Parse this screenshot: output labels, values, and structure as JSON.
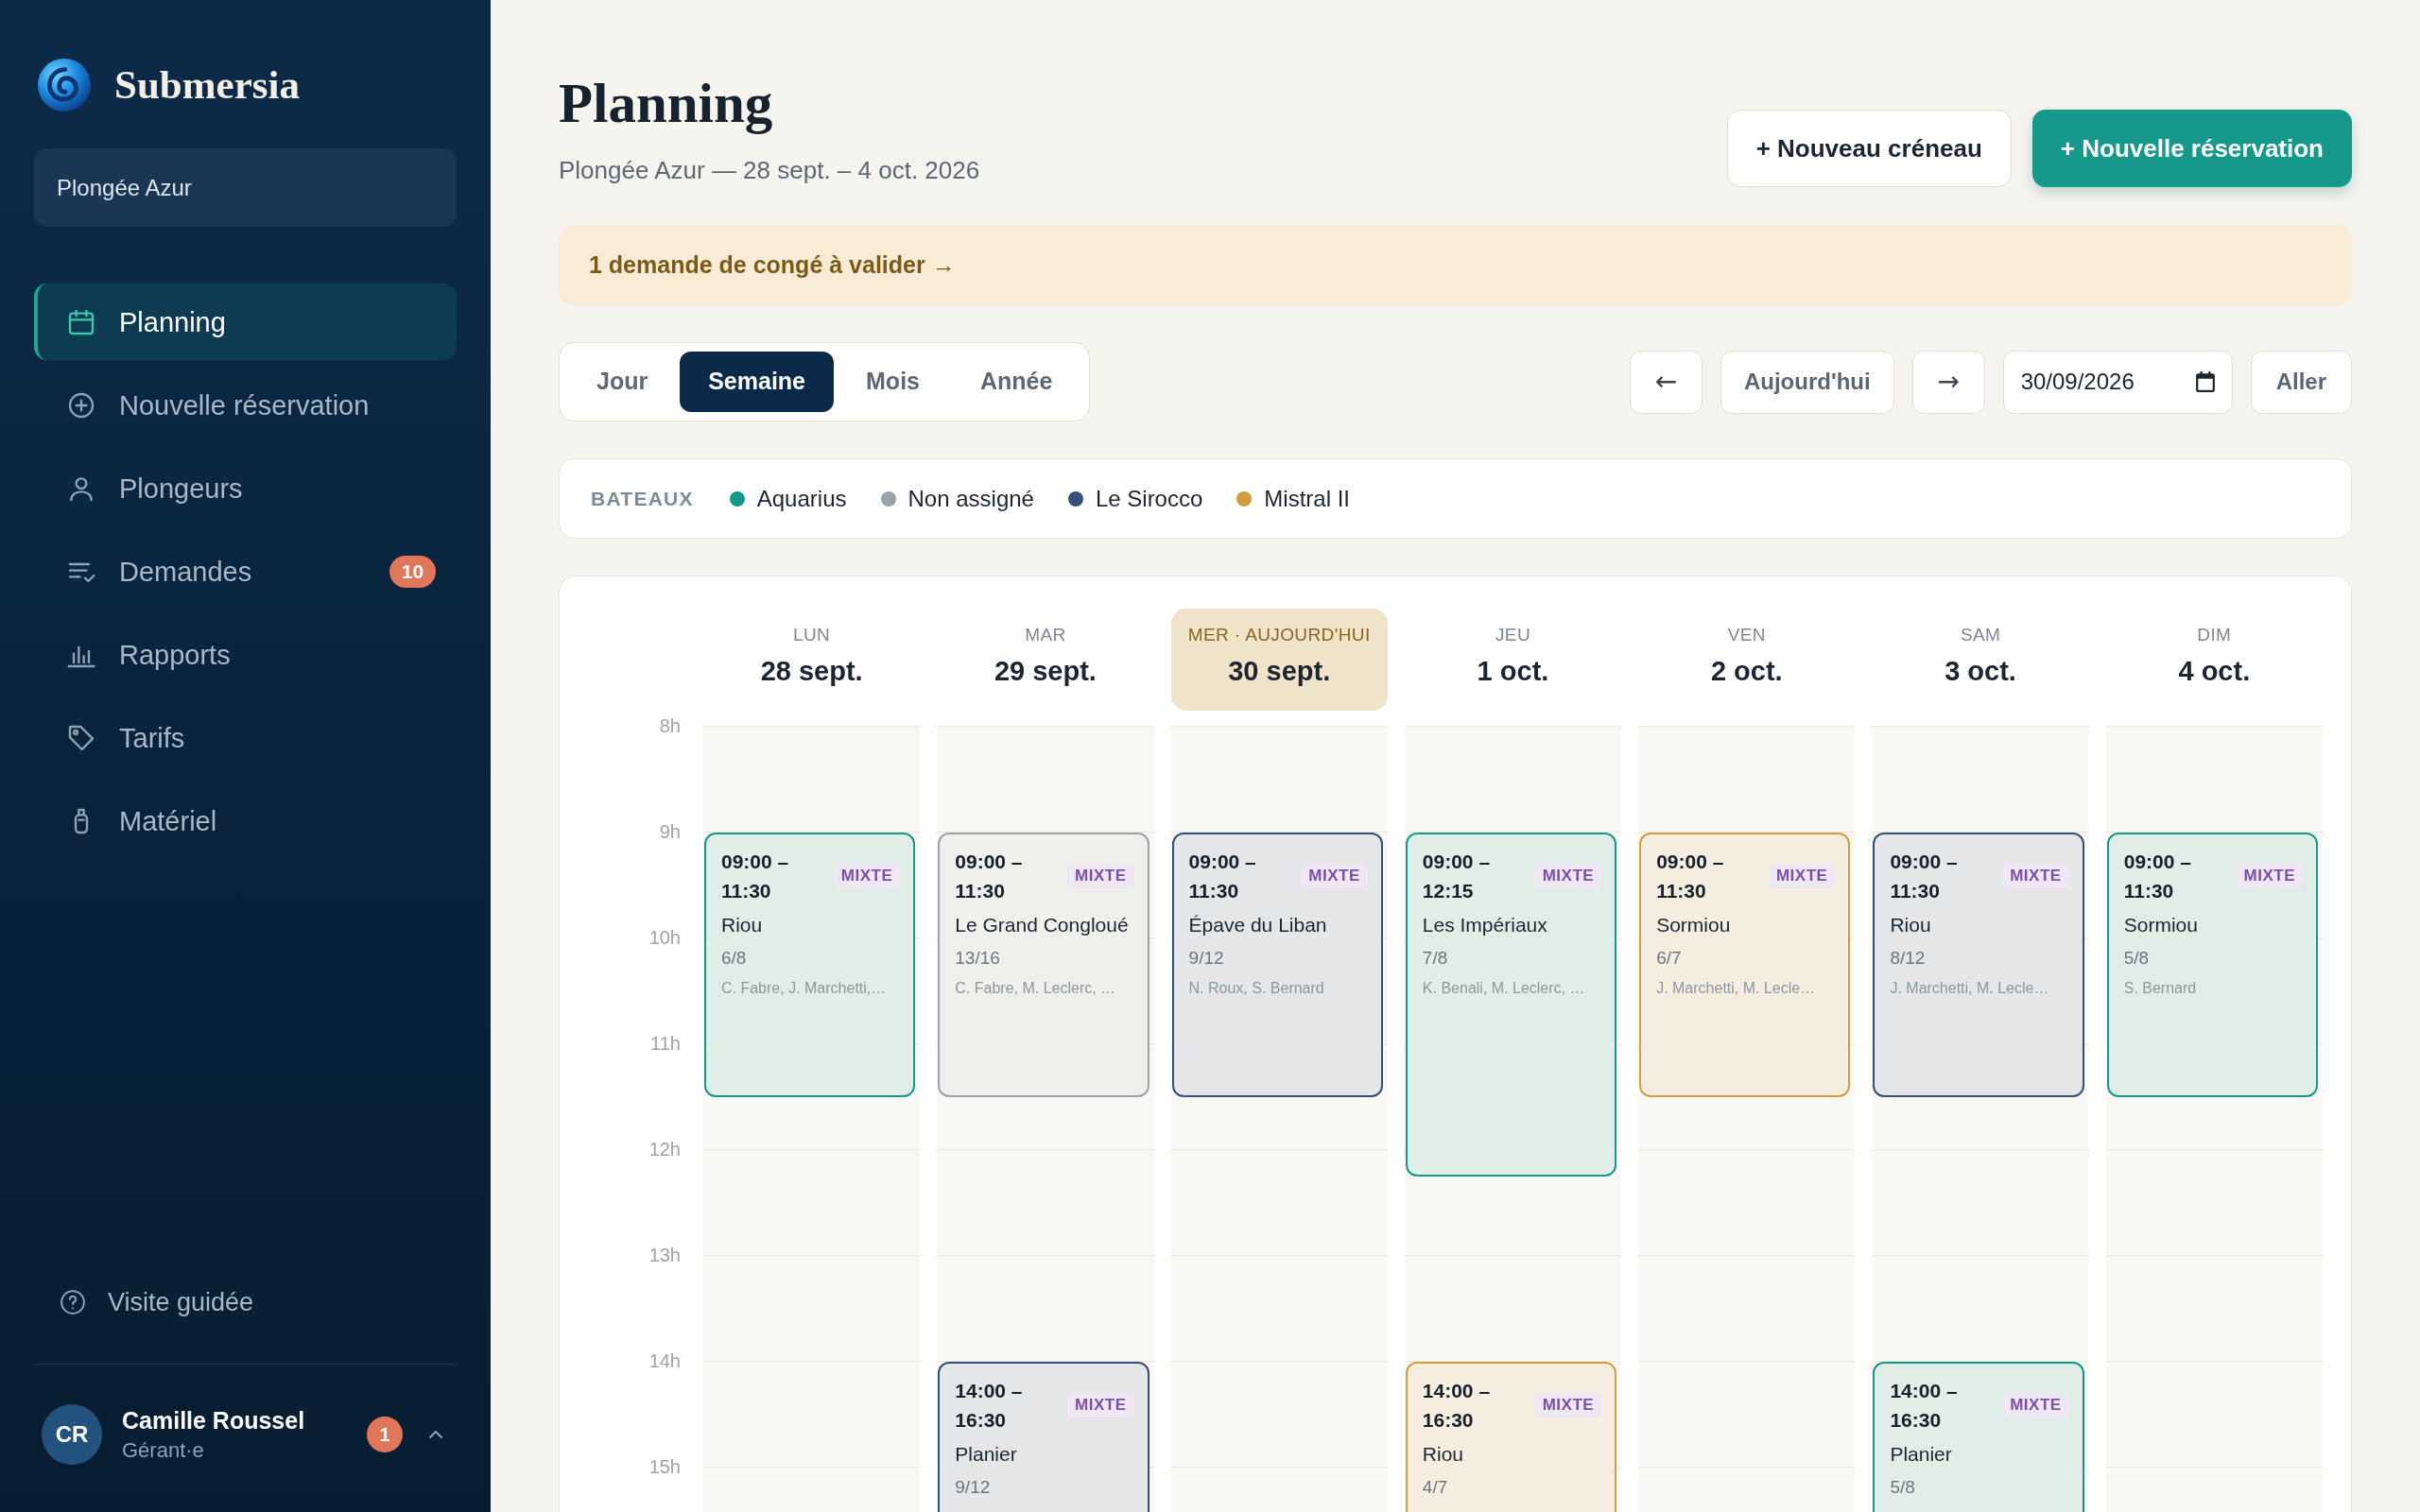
{
  "sidebar": {
    "brand": "Submersia",
    "organization": "Plongée Azur",
    "nav": [
      {
        "label": "Planning",
        "selected": true
      },
      {
        "label": "Nouvelle réservation",
        "selected": false
      },
      {
        "label": "Plongeurs",
        "selected": false
      },
      {
        "label": "Demandes",
        "selected": false,
        "badge": "10"
      },
      {
        "label": "Rapports",
        "selected": false
      },
      {
        "label": "Tarifs",
        "selected": false
      },
      {
        "label": "Matériel",
        "selected": false
      }
    ],
    "help": "Visite guidée",
    "user": {
      "initials": "CR",
      "name": "Camille Roussel",
      "role": "Gérant·e",
      "badge": "1"
    }
  },
  "header": {
    "title": "Planning",
    "subtitle": "Plongée Azur — 28 sept. – 4 oct. 2026",
    "actions": [
      {
        "label": "+ Nouveau créneau",
        "kind": "secondary"
      },
      {
        "label": "+ Nouvelle réservation",
        "kind": "primary"
      }
    ]
  },
  "alert": {
    "text": "1 demande de congé à valider →"
  },
  "views": [
    {
      "label": "Jour",
      "selected": false
    },
    {
      "label": "Semaine",
      "selected": true
    },
    {
      "label": "Mois",
      "selected": false
    },
    {
      "label": "Année",
      "selected": false
    }
  ],
  "navigation": {
    "previous": "←",
    "today": "Aujourd'hui",
    "next": "→",
    "date": "30/09/2026",
    "go": "Aller"
  },
  "legend": {
    "title": "BATEAUX",
    "boats": [
      {
        "name": "Aquarius",
        "color": "#14998a"
      },
      {
        "name": "Non assigné",
        "color": "#9aa2ab"
      },
      {
        "name": "Le Sirocco",
        "color": "#34507a"
      },
      {
        "name": "Mistral II",
        "color": "#d19e3e"
      }
    ]
  },
  "calendar": {
    "hours": [
      "8h",
      "9h",
      "10h",
      "11h",
      "12h",
      "13h",
      "14h",
      "15h"
    ],
    "days": [
      {
        "weekday": "LUN",
        "date": "28 sept.",
        "today": false,
        "events": [
          {
            "time": "09:00 – 11:30",
            "tag": "MIXTE",
            "site": "Riou",
            "places": "6/8",
            "divers": "C. Fabre, J. Marchetti,…",
            "color": "#14998a"
          }
        ]
      },
      {
        "weekday": "MAR",
        "date": "29 sept.",
        "today": false,
        "events": [
          {
            "time": "09:00 – 11:30",
            "tag": "MIXTE",
            "site": "Le Grand Congloué",
            "places": "13/16",
            "divers": "C. Fabre, M. Leclerc, …",
            "color": "#9aa2ab"
          },
          {
            "time": "14:00 – 16:30",
            "tag": "MIXTE",
            "site": "Planier",
            "places": "9/12",
            "color": "#34507a"
          }
        ]
      },
      {
        "weekday": "MER · AUJOURD'HUI",
        "date": "30 sept.",
        "today": true,
        "events": [
          {
            "time": "09:00 – 11:30",
            "tag": "MIXTE",
            "site": "Épave du Liban",
            "places": "9/12",
            "divers": "N. Roux, S. Bernard",
            "color": "#34507a"
          }
        ]
      },
      {
        "weekday": "JEU",
        "date": "1 oct.",
        "today": false,
        "events": [
          {
            "time": "09:00 – 12:15",
            "tag": "MIXTE",
            "site": "Les Impériaux",
            "places": "7/8",
            "divers": "K. Benali, M. Leclerc, …",
            "color": "#14998a"
          },
          {
            "time": "14:00 – 16:30",
            "tag": "MIXTE",
            "site": "Riou",
            "places": "4/7",
            "color": "#d19e3e"
          }
        ]
      },
      {
        "weekday": "VEN",
        "date": "2 oct.",
        "today": false,
        "events": [
          {
            "time": "09:00 – 11:30",
            "tag": "MIXTE",
            "site": "Sormiou",
            "places": "6/7",
            "divers": "J. Marchetti, M. Lecle…",
            "color": "#d19e3e"
          }
        ]
      },
      {
        "weekday": "SAM",
        "date": "3 oct.",
        "today": false,
        "events": [
          {
            "time": "09:00 – 11:30",
            "tag": "MIXTE",
            "site": "Riou",
            "places": "8/12",
            "divers": "J. Marchetti, M. Lecle…",
            "color": "#34507a"
          },
          {
            "time": "14:00 – 16:30",
            "tag": "MIXTE",
            "site": "Planier",
            "places": "5/8",
            "color": "#14998a"
          }
        ]
      },
      {
        "weekday": "DIM",
        "date": "4 oct.",
        "today": false,
        "events": [
          {
            "time": "09:00 – 11:30",
            "tag": "MIXTE",
            "site": "Sormiou",
            "places": "5/8",
            "divers": "S. Bernard",
            "color": "#14998a"
          }
        ]
      }
    ]
  }
}
